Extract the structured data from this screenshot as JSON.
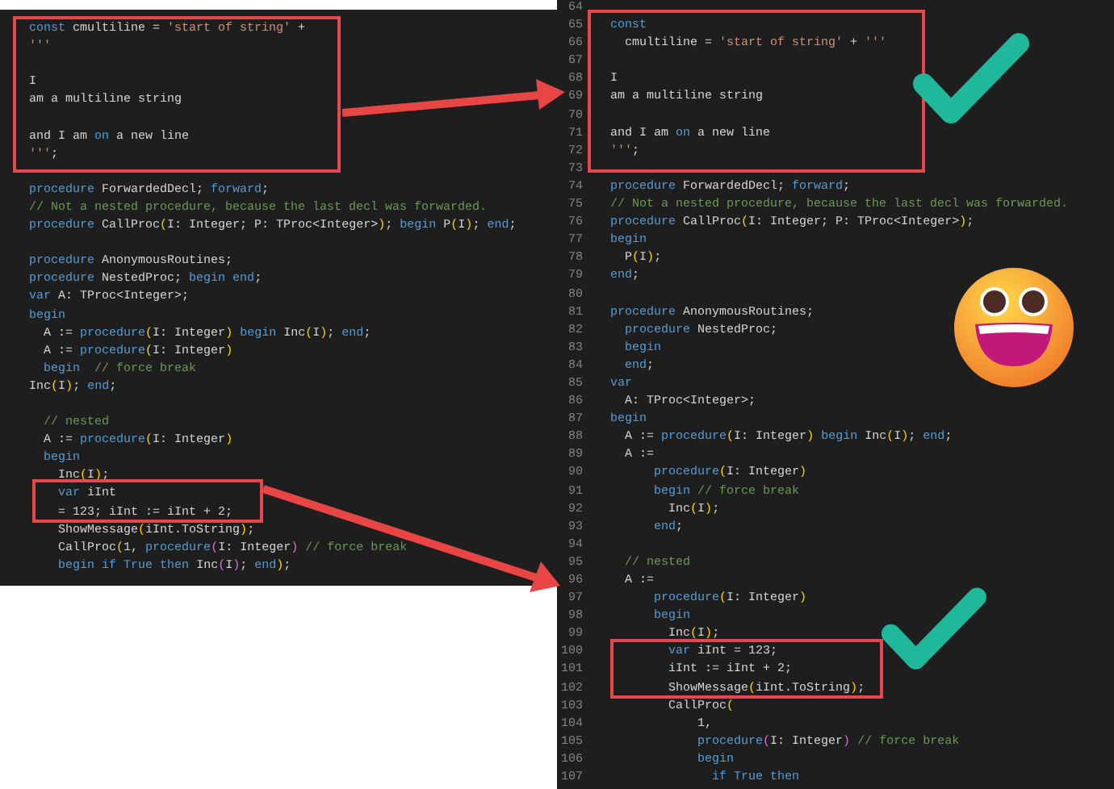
{
  "left_panel": {
    "blocks": [
      [
        {
          "tokens": [
            {
              "text": "const",
              "kind": "kw"
            },
            {
              "text": " cmultiline = ",
              "kind": "txt"
            },
            {
              "text": "'start of string'",
              "kind": "str"
            },
            {
              "text": " +",
              "kind": "txt"
            }
          ]
        },
        {
          "tokens": [
            {
              "text": "'''",
              "kind": "str"
            }
          ]
        }
      ],
      [
        {
          "tokens": [
            {
              "text": "I",
              "kind": "txt"
            }
          ]
        },
        {
          "tokens": [
            {
              "text": "am a multiline string",
              "kind": "txt"
            }
          ]
        }
      ],
      [
        {
          "tokens": [
            {
              "text": "and I am ",
              "kind": "txt"
            },
            {
              "text": "on",
              "kind": "kw"
            },
            {
              "text": " a new line",
              "kind": "txt"
            }
          ]
        },
        {
          "tokens": [
            {
              "text": "'''",
              "kind": "str"
            },
            {
              "text": ";",
              "kind": "txt"
            }
          ]
        }
      ],
      [
        {
          "tokens": [
            {
              "text": "procedure",
              "kind": "kw"
            },
            {
              "text": " ForwardedDecl; ",
              "kind": "txt"
            },
            {
              "text": "forward",
              "kind": "kw"
            },
            {
              "text": ";",
              "kind": "txt"
            }
          ]
        },
        {
          "tokens": [
            {
              "text": "// Not a nested procedure, because the last decl was forwarded.",
              "kind": "com"
            }
          ]
        },
        {
          "tokens": [
            {
              "text": "procedure",
              "kind": "kw"
            },
            {
              "text": " CallProc",
              "kind": "txt"
            },
            {
              "text": "(",
              "kind": "br"
            },
            {
              "text": "I: Integer; P: TProc<Integer>",
              "kind": "txt"
            },
            {
              "text": ")",
              "kind": "br"
            },
            {
              "text": "; ",
              "kind": "txt"
            },
            {
              "text": "begin",
              "kind": "kw"
            },
            {
              "text": " P",
              "kind": "txt"
            },
            {
              "text": "(",
              "kind": "br"
            },
            {
              "text": "I",
              "kind": "txt"
            },
            {
              "text": ")",
              "kind": "br"
            },
            {
              "text": "; ",
              "kind": "txt"
            },
            {
              "text": "end",
              "kind": "kw"
            },
            {
              "text": ";",
              "kind": "txt"
            }
          ]
        }
      ],
      [
        {
          "tokens": [
            {
              "text": "procedure",
              "kind": "kw"
            },
            {
              "text": " AnonymousRoutines;",
              "kind": "txt"
            }
          ]
        },
        {
          "tokens": [
            {
              "text": "procedure",
              "kind": "kw"
            },
            {
              "text": " NestedProc; ",
              "kind": "txt"
            },
            {
              "text": "begin",
              "kind": "kw"
            },
            {
              "text": " end",
              "kind": "kw"
            },
            {
              "text": ";",
              "kind": "txt"
            }
          ]
        },
        {
          "tokens": [
            {
              "text": "var",
              "kind": "kw"
            },
            {
              "text": " A: TProc<Integer>;",
              "kind": "txt"
            }
          ]
        },
        {
          "tokens": [
            {
              "text": "begin",
              "kind": "kw"
            }
          ]
        },
        {
          "tokens": [
            {
              "text": "  A := ",
              "kind": "txt"
            },
            {
              "text": "procedure",
              "kind": "kw"
            },
            {
              "text": "(",
              "kind": "br"
            },
            {
              "text": "I: Integer",
              "kind": "txt"
            },
            {
              "text": ")",
              "kind": "br"
            },
            {
              "text": " begin",
              "kind": "kw"
            },
            {
              "text": " Inc",
              "kind": "txt"
            },
            {
              "text": "(",
              "kind": "br"
            },
            {
              "text": "I",
              "kind": "txt"
            },
            {
              "text": ")",
              "kind": "br"
            },
            {
              "text": "; ",
              "kind": "txt"
            },
            {
              "text": "end",
              "kind": "kw"
            },
            {
              "text": ";",
              "kind": "txt"
            }
          ]
        },
        {
          "tokens": [
            {
              "text": "  A := ",
              "kind": "txt"
            },
            {
              "text": "procedure",
              "kind": "kw"
            },
            {
              "text": "(",
              "kind": "br"
            },
            {
              "text": "I: Integer",
              "kind": "txt"
            },
            {
              "text": ")",
              "kind": "br"
            }
          ]
        },
        {
          "tokens": [
            {
              "text": "  begin",
              "kind": "kw"
            },
            {
              "text": "  // force break",
              "kind": "com"
            }
          ]
        },
        {
          "tokens": [
            {
              "text": "Inc",
              "kind": "txt"
            },
            {
              "text": "(",
              "kind": "br"
            },
            {
              "text": "I",
              "kind": "txt"
            },
            {
              "text": ")",
              "kind": "br"
            },
            {
              "text": "; ",
              "kind": "txt"
            },
            {
              "text": "end",
              "kind": "kw"
            },
            {
              "text": ";",
              "kind": "txt"
            }
          ]
        }
      ],
      [
        {
          "tokens": [
            {
              "text": "  // nested",
              "kind": "com"
            }
          ]
        },
        {
          "tokens": [
            {
              "text": "  A := ",
              "kind": "txt"
            },
            {
              "text": "procedure",
              "kind": "kw"
            },
            {
              "text": "(",
              "kind": "br"
            },
            {
              "text": "I: Integer",
              "kind": "txt"
            },
            {
              "text": ")",
              "kind": "br"
            }
          ]
        },
        {
          "tokens": [
            {
              "text": "  begin",
              "kind": "kw"
            }
          ]
        },
        {
          "tokens": [
            {
              "text": "    Inc",
              "kind": "txt"
            },
            {
              "text": "(",
              "kind": "br"
            },
            {
              "text": "I",
              "kind": "txt"
            },
            {
              "text": ")",
              "kind": "br"
            },
            {
              "text": ";",
              "kind": "txt"
            }
          ]
        },
        {
          "tokens": [
            {
              "text": "    var",
              "kind": "kw"
            },
            {
              "text": " iInt",
              "kind": "txt"
            }
          ]
        },
        {
          "tokens": [
            {
              "text": "    = 123; iInt := iInt + 2;",
              "kind": "txt"
            }
          ]
        },
        {
          "tokens": [
            {
              "text": "    ShowMessage",
              "kind": "txt"
            },
            {
              "text": "(",
              "kind": "br"
            },
            {
              "text": "iInt.ToString",
              "kind": "txt"
            },
            {
              "text": ")",
              "kind": "br"
            },
            {
              "text": ";",
              "kind": "txt"
            }
          ]
        },
        {
          "tokens": [
            {
              "text": "    CallProc",
              "kind": "txt"
            },
            {
              "text": "(",
              "kind": "br"
            },
            {
              "text": "1, ",
              "kind": "txt"
            },
            {
              "text": "procedure",
              "kind": "kw"
            },
            {
              "text": "(",
              "kind": "br2"
            },
            {
              "text": "I: Integer",
              "kind": "txt"
            },
            {
              "text": ")",
              "kind": "br2"
            },
            {
              "text": " // force break",
              "kind": "com"
            }
          ]
        },
        {
          "tokens": [
            {
              "text": "    begin",
              "kind": "kw"
            },
            {
              "text": " if",
              "kind": "kw"
            },
            {
              "text": " True",
              "kind": "kw"
            },
            {
              "text": " then",
              "kind": "kw"
            },
            {
              "text": " Inc",
              "kind": "txt"
            },
            {
              "text": "(",
              "kind": "br2"
            },
            {
              "text": "I",
              "kind": "txt"
            },
            {
              "text": ")",
              "kind": "br2"
            },
            {
              "text": "; ",
              "kind": "txt"
            },
            {
              "text": "end",
              "kind": "kw"
            },
            {
              "text": ")",
              "kind": "br"
            },
            {
              "text": ";",
              "kind": "txt"
            }
          ]
        }
      ]
    ]
  },
  "right_panel": {
    "lines": [
      {
        "number": "64"
      },
      {
        "number": "65",
        "tokens": [
          {
            "text": "const",
            "kind": "kw"
          }
        ]
      },
      {
        "number": "66",
        "tokens": [
          {
            "text": "  cmultiline = ",
            "kind": "txt"
          },
          {
            "text": "'start of string'",
            "kind": "str"
          },
          {
            "text": " + ",
            "kind": "txt"
          },
          {
            "text": "'''",
            "kind": "str"
          }
        ]
      },
      {
        "number": "67"
      },
      {
        "number": "68",
        "tokens": [
          {
            "text": "I",
            "kind": "txt"
          }
        ]
      },
      {
        "number": "69",
        "tokens": [
          {
            "text": "am a multiline string",
            "kind": "txt"
          }
        ]
      },
      {
        "number": "70"
      },
      {
        "number": "71",
        "tokens": [
          {
            "text": "and I am ",
            "kind": "txt"
          },
          {
            "text": "on",
            "kind": "kw"
          },
          {
            "text": " a new line",
            "kind": "txt"
          }
        ]
      },
      {
        "number": "72",
        "tokens": [
          {
            "text": "'''",
            "kind": "str"
          },
          {
            "text": ";",
            "kind": "txt"
          }
        ]
      },
      {
        "number": "73"
      },
      {
        "number": "74",
        "tokens": [
          {
            "text": "procedure",
            "kind": "kw"
          },
          {
            "text": " ForwardedDecl; ",
            "kind": "txt"
          },
          {
            "text": "forward",
            "kind": "kw"
          },
          {
            "text": ";",
            "kind": "txt"
          }
        ]
      },
      {
        "number": "75",
        "tokens": [
          {
            "text": "// Not a nested procedure, because the last decl was forwarded.",
            "kind": "com"
          }
        ]
      },
      {
        "number": "76",
        "tokens": [
          {
            "text": "procedure",
            "kind": "kw"
          },
          {
            "text": " CallProc",
            "kind": "txt"
          },
          {
            "text": "(",
            "kind": "br"
          },
          {
            "text": "I: Integer; P: TProc<Integer>",
            "kind": "txt"
          },
          {
            "text": ")",
            "kind": "br"
          },
          {
            "text": ";",
            "kind": "txt"
          }
        ]
      },
      {
        "number": "77",
        "tokens": [
          {
            "text": "begin",
            "kind": "kw"
          }
        ]
      },
      {
        "number": "78",
        "tokens": [
          {
            "text": "  P",
            "kind": "txt"
          },
          {
            "text": "(",
            "kind": "br"
          },
          {
            "text": "I",
            "kind": "txt"
          },
          {
            "text": ")",
            "kind": "br"
          },
          {
            "text": ";",
            "kind": "txt"
          }
        ]
      },
      {
        "number": "79",
        "tokens": [
          {
            "text": "end",
            "kind": "kw"
          },
          {
            "text": ";",
            "kind": "txt"
          }
        ]
      },
      {
        "number": "80"
      },
      {
        "number": "81",
        "tokens": [
          {
            "text": "procedure",
            "kind": "kw"
          },
          {
            "text": " AnonymousRoutines;",
            "kind": "txt"
          }
        ]
      },
      {
        "number": "82",
        "tokens": [
          {
            "text": "  procedure",
            "kind": "kw"
          },
          {
            "text": " NestedProc;",
            "kind": "txt"
          }
        ]
      },
      {
        "number": "83",
        "tokens": [
          {
            "text": "  begin",
            "kind": "kw"
          }
        ]
      },
      {
        "number": "84",
        "tokens": [
          {
            "text": "  end",
            "kind": "kw"
          },
          {
            "text": ";",
            "kind": "txt"
          }
        ]
      },
      {
        "number": "85",
        "tokens": [
          {
            "text": "var",
            "kind": "kw"
          }
        ]
      },
      {
        "number": "86",
        "tokens": [
          {
            "text": "  A: TProc<Integer>;",
            "kind": "txt"
          }
        ]
      },
      {
        "number": "87",
        "tokens": [
          {
            "text": "begin",
            "kind": "kw"
          }
        ]
      },
      {
        "number": "88",
        "tokens": [
          {
            "text": "  A := ",
            "kind": "txt"
          },
          {
            "text": "procedure",
            "kind": "kw"
          },
          {
            "text": "(",
            "kind": "br"
          },
          {
            "text": "I: Integer",
            "kind": "txt"
          },
          {
            "text": ")",
            "kind": "br"
          },
          {
            "text": " begin",
            "kind": "kw"
          },
          {
            "text": " Inc",
            "kind": "txt"
          },
          {
            "text": "(",
            "kind": "br"
          },
          {
            "text": "I",
            "kind": "txt"
          },
          {
            "text": ")",
            "kind": "br"
          },
          {
            "text": "; ",
            "kind": "txt"
          },
          {
            "text": "end",
            "kind": "kw"
          },
          {
            "text": ";",
            "kind": "txt"
          }
        ]
      },
      {
        "number": "89",
        "tokens": [
          {
            "text": "  A :=",
            "kind": "txt"
          }
        ]
      },
      {
        "number": "90",
        "tokens": [
          {
            "text": "      procedure",
            "kind": "kw"
          },
          {
            "text": "(",
            "kind": "br"
          },
          {
            "text": "I: Integer",
            "kind": "txt"
          },
          {
            "text": ")",
            "kind": "br"
          }
        ]
      },
      {
        "number": "91",
        "tokens": [
          {
            "text": "      begin",
            "kind": "kw"
          },
          {
            "text": " // force break",
            "kind": "com"
          }
        ]
      },
      {
        "number": "92",
        "tokens": [
          {
            "text": "        Inc",
            "kind": "txt"
          },
          {
            "text": "(",
            "kind": "br"
          },
          {
            "text": "I",
            "kind": "txt"
          },
          {
            "text": ")",
            "kind": "br"
          },
          {
            "text": ";",
            "kind": "txt"
          }
        ]
      },
      {
        "number": "93",
        "tokens": [
          {
            "text": "      end",
            "kind": "kw"
          },
          {
            "text": ";",
            "kind": "txt"
          }
        ]
      },
      {
        "number": "94"
      },
      {
        "number": "95",
        "tokens": [
          {
            "text": "  // nested",
            "kind": "com"
          }
        ]
      },
      {
        "number": "96",
        "tokens": [
          {
            "text": "  A :=",
            "kind": "txt"
          }
        ]
      },
      {
        "number": "97",
        "tokens": [
          {
            "text": "      procedure",
            "kind": "kw"
          },
          {
            "text": "(",
            "kind": "br"
          },
          {
            "text": "I: Integer",
            "kind": "txt"
          },
          {
            "text": ")",
            "kind": "br"
          }
        ]
      },
      {
        "number": "98",
        "tokens": [
          {
            "text": "      begin",
            "kind": "kw"
          }
        ]
      },
      {
        "number": "99",
        "tokens": [
          {
            "text": "        Inc",
            "kind": "txt"
          },
          {
            "text": "(",
            "kind": "br"
          },
          {
            "text": "I",
            "kind": "txt"
          },
          {
            "text": ")",
            "kind": "br"
          },
          {
            "text": ";",
            "kind": "txt"
          }
        ]
      },
      {
        "number": "100",
        "tokens": [
          {
            "text": "        var",
            "kind": "kw"
          },
          {
            "text": " iInt = 123;",
            "kind": "txt"
          }
        ]
      },
      {
        "number": "101",
        "tokens": [
          {
            "text": "        iInt := iInt + 2;",
            "kind": "txt"
          }
        ]
      },
      {
        "number": "102",
        "tokens": [
          {
            "text": "        ShowMessage",
            "kind": "txt"
          },
          {
            "text": "(",
            "kind": "br"
          },
          {
            "text": "iInt.ToString",
            "kind": "txt"
          },
          {
            "text": ")",
            "kind": "br"
          },
          {
            "text": ";",
            "kind": "txt"
          }
        ]
      },
      {
        "number": "103",
        "tokens": [
          {
            "text": "        CallProc",
            "kind": "txt"
          },
          {
            "text": "(",
            "kind": "br"
          }
        ]
      },
      {
        "number": "104",
        "tokens": [
          {
            "text": "            1,",
            "kind": "txt"
          }
        ]
      },
      {
        "number": "105",
        "tokens": [
          {
            "text": "            procedure",
            "kind": "kw"
          },
          {
            "text": "(",
            "kind": "br2"
          },
          {
            "text": "I: Integer",
            "kind": "txt"
          },
          {
            "text": ")",
            "kind": "br2"
          },
          {
            "text": " // force break",
            "kind": "com"
          }
        ]
      },
      {
        "number": "106",
        "tokens": [
          {
            "text": "            begin",
            "kind": "kw"
          }
        ]
      },
      {
        "number": "107",
        "tokens": [
          {
            "text": "              if",
            "kind": "kw"
          },
          {
            "text": " True",
            "kind": "kw"
          },
          {
            "text": " then",
            "kind": "kw"
          }
        ]
      }
    ]
  }
}
